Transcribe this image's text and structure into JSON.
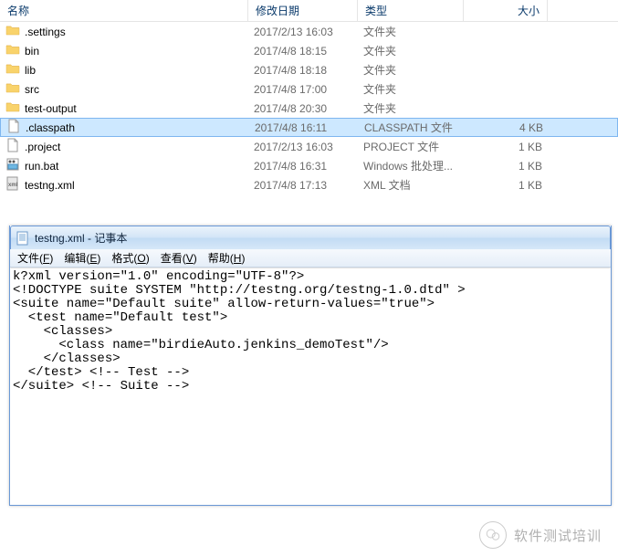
{
  "explorer": {
    "headers": {
      "name": "名称",
      "date": "修改日期",
      "type": "类型",
      "size": "大小"
    },
    "rows": [
      {
        "icon": "folder",
        "name": ".settings",
        "date": "2017/2/13 16:03",
        "type": "文件夹",
        "size": "",
        "selected": false
      },
      {
        "icon": "folder",
        "name": "bin",
        "date": "2017/4/8 18:15",
        "type": "文件夹",
        "size": "",
        "selected": false
      },
      {
        "icon": "folder",
        "name": "lib",
        "date": "2017/4/8 18:18",
        "type": "文件夹",
        "size": "",
        "selected": false
      },
      {
        "icon": "folder",
        "name": "src",
        "date": "2017/4/8 17:00",
        "type": "文件夹",
        "size": "",
        "selected": false
      },
      {
        "icon": "folder",
        "name": "test-output",
        "date": "2017/4/8 20:30",
        "type": "文件夹",
        "size": "",
        "selected": false
      },
      {
        "icon": "file",
        "name": ".classpath",
        "date": "2017/4/8 16:11",
        "type": "CLASSPATH 文件",
        "size": "4 KB",
        "selected": true
      },
      {
        "icon": "file",
        "name": ".project",
        "date": "2017/2/13 16:03",
        "type": "PROJECT 文件",
        "size": "1 KB",
        "selected": false
      },
      {
        "icon": "bat",
        "name": "run.bat",
        "date": "2017/4/8 16:31",
        "type": "Windows 批处理...",
        "size": "1 KB",
        "selected": false
      },
      {
        "icon": "xml",
        "name": "testng.xml",
        "date": "2017/4/8 17:13",
        "type": "XML 文档",
        "size": "1 KB",
        "selected": false
      }
    ]
  },
  "notepad": {
    "title": "testng.xml - 记事本",
    "menu": [
      {
        "label": "文件",
        "accel": "F"
      },
      {
        "label": "编辑",
        "accel": "E"
      },
      {
        "label": "格式",
        "accel": "O"
      },
      {
        "label": "查看",
        "accel": "V"
      },
      {
        "label": "帮助",
        "accel": "H"
      }
    ],
    "content": "k?xml version=\"1.0\" encoding=\"UTF-8\"?>\n<!DOCTYPE suite SYSTEM \"http://testng.org/testng-1.0.dtd\" >\n<suite name=\"Default suite\" allow-return-values=\"true\">\n  <test name=\"Default test\">\n    <classes>\n      <class name=\"birdieAuto.jenkins_demoTest\"/>\n    </classes>\n  </test> <!-- Test -->\n</suite> <!-- Suite -->"
  },
  "watermark": {
    "text": "软件测试培训"
  }
}
